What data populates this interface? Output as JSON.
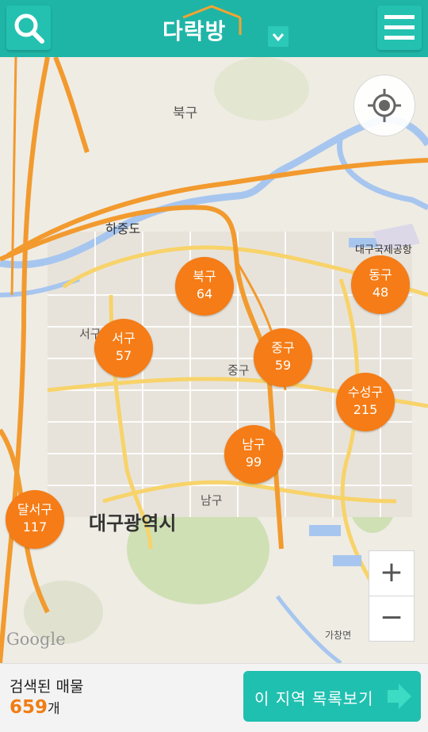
{
  "header": {
    "logo_text": "다락방",
    "icons": {
      "search": "search-icon",
      "menu": "menu-icon",
      "dropdown": "chevron-down-icon"
    }
  },
  "map": {
    "place_labels": {
      "bukgu": "북구",
      "hajungdo": "하중도",
      "airport": "대구국제공항",
      "seogu": "서구",
      "junggu": "중구",
      "namgu": "남구",
      "daegu": "대구광역시",
      "gachang": "가창면",
      "google": "Google"
    },
    "markers": [
      {
        "name": "북구",
        "count": "64"
      },
      {
        "name": "동구",
        "count": "48"
      },
      {
        "name": "서구",
        "count": "57"
      },
      {
        "name": "중구",
        "count": "59"
      },
      {
        "name": "수성구",
        "count": "215"
      },
      {
        "name": "남구",
        "count": "99"
      },
      {
        "name": "달서구",
        "count": "117"
      }
    ],
    "controls": {
      "zoom_in": "+",
      "zoom_out": "−",
      "locate_icon": "crosshair-icon"
    }
  },
  "footer": {
    "result_label": "검색된 매물",
    "result_count": "659",
    "result_unit": "개",
    "list_button": "이 지역 목록보기",
    "list_button_icon": "arrow-right-icon"
  },
  "colors": {
    "brand": "#1fb5a6",
    "marker": "#f57c16",
    "count": "#f07d14"
  }
}
